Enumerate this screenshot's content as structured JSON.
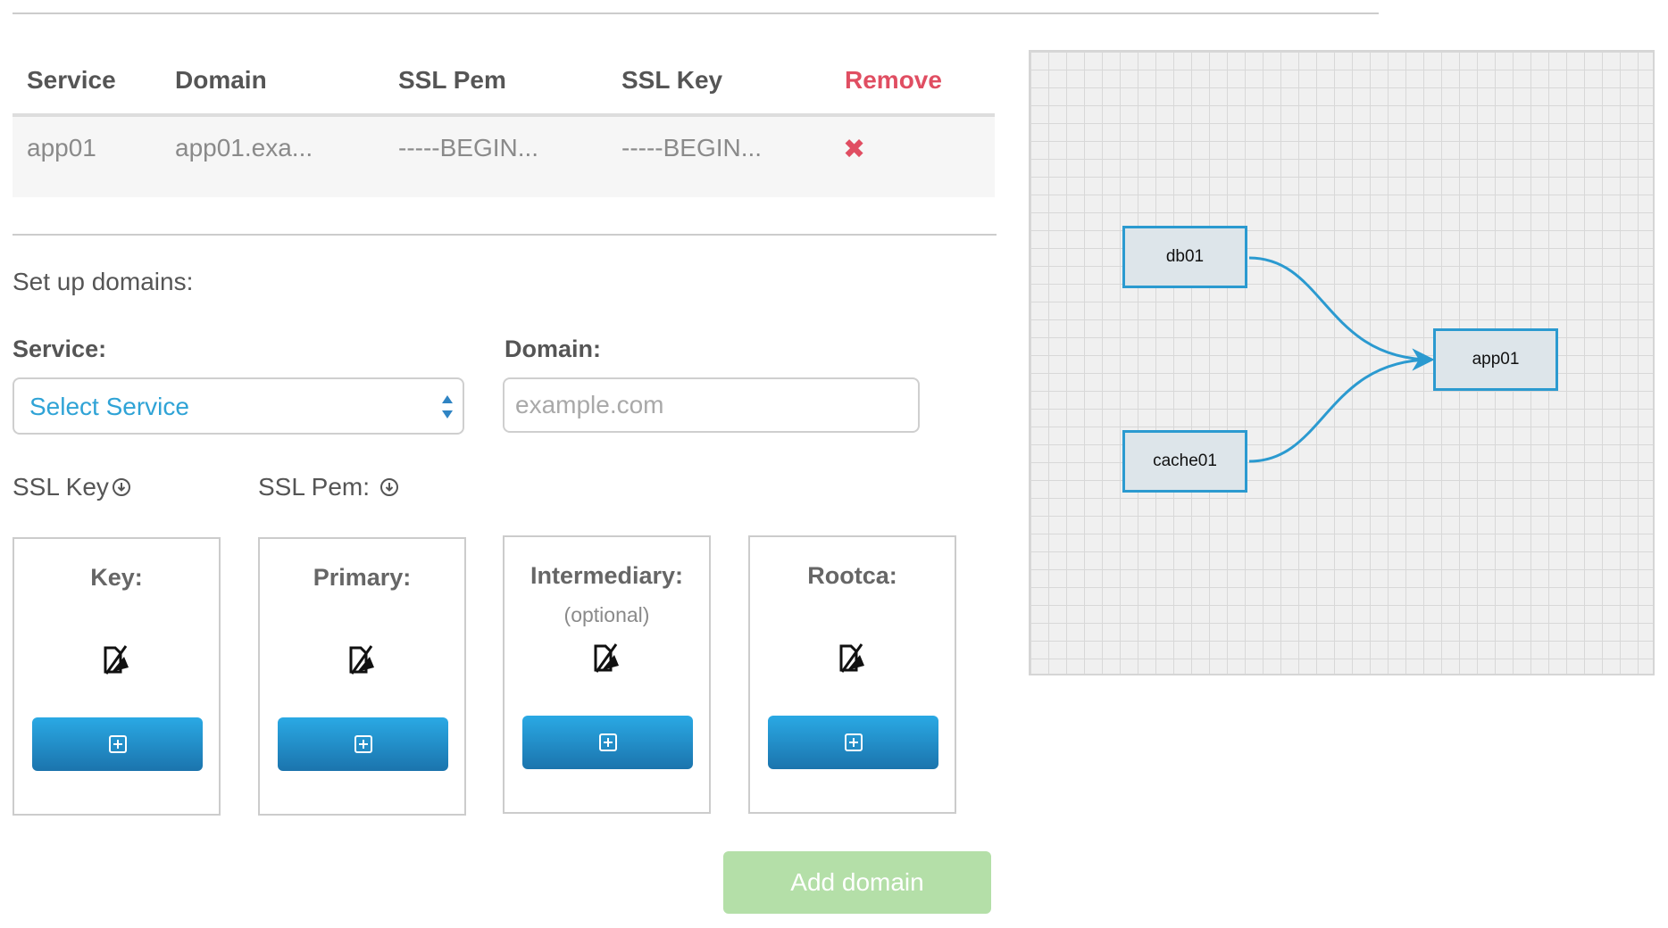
{
  "table": {
    "headers": {
      "service": "Service",
      "domain": "Domain",
      "ssl_pem": "SSL Pem",
      "ssl_key": "SSL Key",
      "remove": "Remove"
    },
    "rows": [
      {
        "service": "app01",
        "domain": "app01.exa...",
        "ssl_pem": "-----BEGIN...",
        "ssl_key": "-----BEGIN...",
        "remove_icon": "close-icon"
      }
    ]
  },
  "form": {
    "title": "Set up domains:",
    "service_label": "Service:",
    "service_select_value": "Select Service",
    "domain_label": "Domain:",
    "domain_placeholder": "example.com",
    "ssl_key_label": "SSL Key",
    "ssl_pem_label": "SSL Pem:",
    "cards": [
      {
        "title": "Key:",
        "subtitle": "",
        "icon": "no-file-icon",
        "button_icon": "plus-square-icon"
      },
      {
        "title": "Primary:",
        "subtitle": "",
        "icon": "no-file-icon",
        "button_icon": "plus-square-icon"
      },
      {
        "title": "Intermediary:",
        "subtitle": "(optional)",
        "icon": "no-file-icon",
        "button_icon": "plus-square-icon"
      },
      {
        "title": "Rootca:",
        "subtitle": "",
        "icon": "no-file-icon",
        "button_icon": "plus-square-icon"
      }
    ],
    "add_button": "Add domain"
  },
  "diagram": {
    "nodes": [
      "db01",
      "app01",
      "cache01"
    ],
    "edges": [
      {
        "from": "db01",
        "to": "app01"
      },
      {
        "from": "cache01",
        "to": "app01"
      }
    ]
  },
  "colors": {
    "accent": "#2fa3d6",
    "remove": "#e04e62",
    "add_button": "#b4dfa8",
    "node_border": "#2b9ad0"
  }
}
